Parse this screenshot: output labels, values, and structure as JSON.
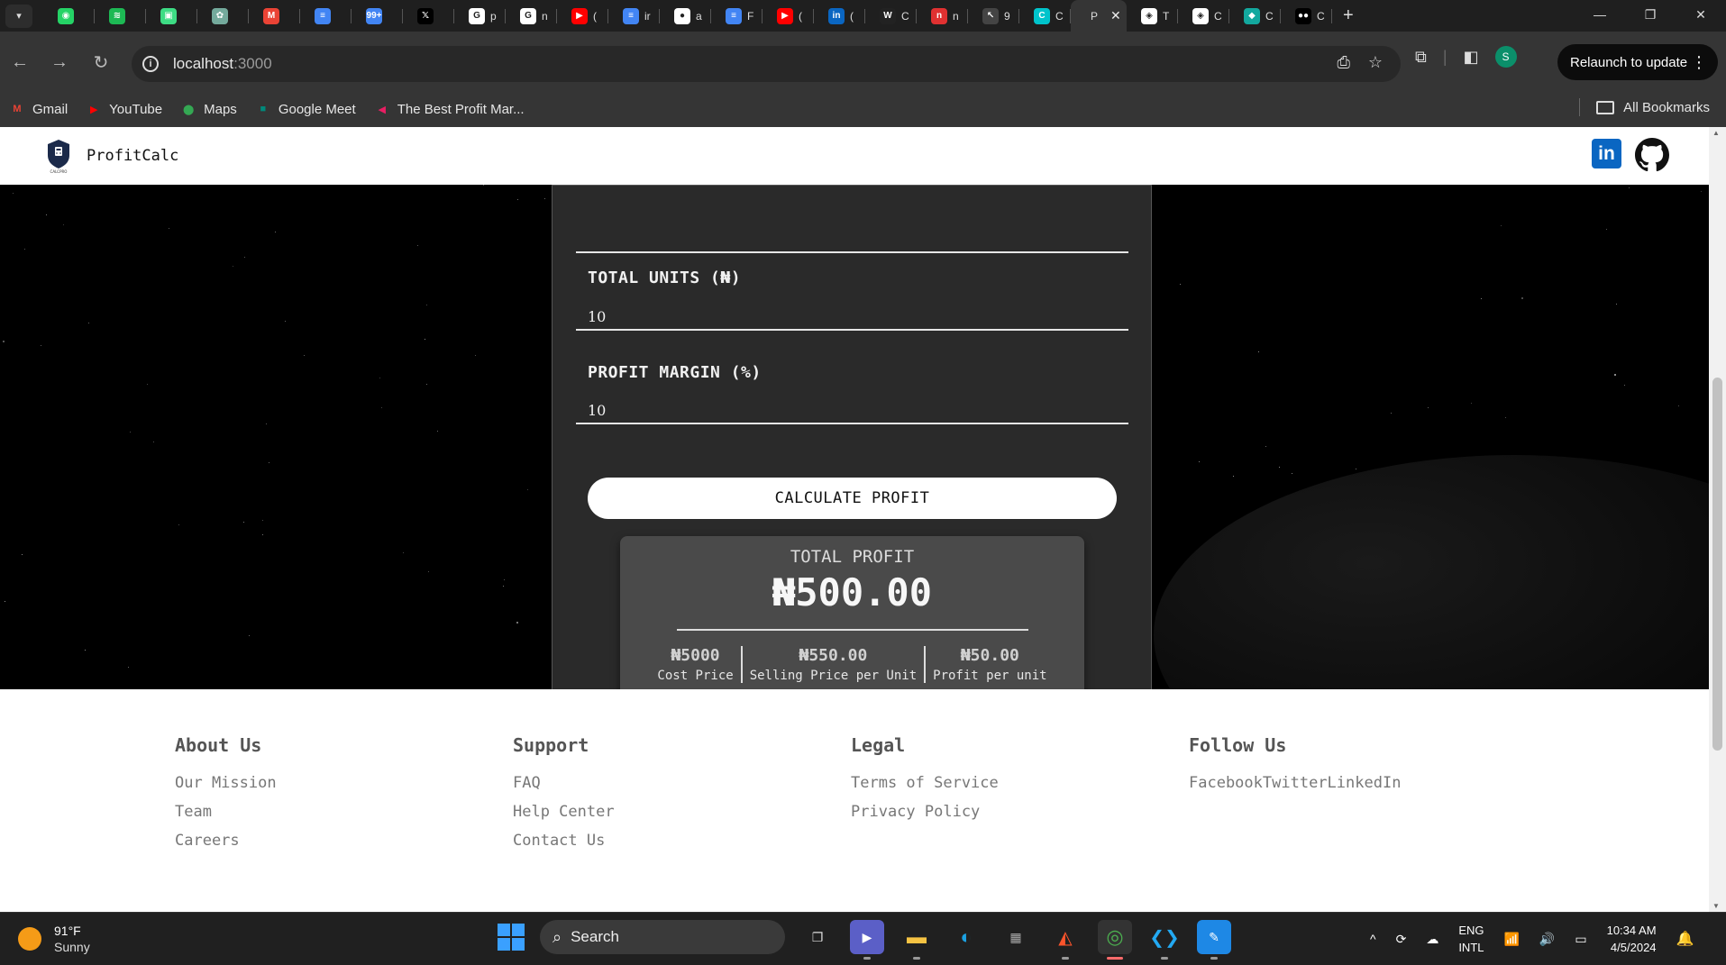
{
  "browser": {
    "tabs": [
      {
        "icon": "whatsapp-icon",
        "color": "#25d366",
        "glyph": "◉",
        "label": ""
      },
      {
        "icon": "spotify-icon",
        "color": "#1db954",
        "glyph": "≋",
        "label": ""
      },
      {
        "icon": "android-icon",
        "color": "#3ddc84",
        "glyph": "▣",
        "label": ""
      },
      {
        "icon": "chatgpt-icon",
        "color": "#74aa9c",
        "glyph": "✿",
        "label": ""
      },
      {
        "icon": "gmail-icon",
        "color": "#ea4335",
        "glyph": "M",
        "label": ""
      },
      {
        "icon": "docs-icon",
        "color": "#4285f4",
        "glyph": "≡",
        "label": ""
      },
      {
        "icon": "badge-icon",
        "color": "#4285f4",
        "glyph": "99+",
        "label": ""
      },
      {
        "icon": "x-icon",
        "color": "#000000",
        "glyph": "𝕏",
        "label": ""
      },
      {
        "icon": "google-icon",
        "color": "#ffffff",
        "glyph": "G",
        "label": "p"
      },
      {
        "icon": "google-icon",
        "color": "#ffffff",
        "glyph": "G",
        "label": "n"
      },
      {
        "icon": "youtube-icon",
        "color": "#ff0000",
        "glyph": "▶",
        "label": "("
      },
      {
        "icon": "docs-icon",
        "color": "#4285f4",
        "glyph": "≡",
        "label": "ir"
      },
      {
        "icon": "github-icon",
        "color": "#ffffff",
        "glyph": "●",
        "label": "a"
      },
      {
        "icon": "docs-icon",
        "color": "#4285f4",
        "glyph": "≡",
        "label": "F"
      },
      {
        "icon": "youtube-icon",
        "color": "#ff0000",
        "glyph": "▶",
        "label": "("
      },
      {
        "icon": "linkedin-icon",
        "color": "#0a66c2",
        "glyph": "in",
        "label": "("
      },
      {
        "icon": "w-icon",
        "color": "#222222",
        "glyph": "W",
        "label": "C"
      },
      {
        "icon": "n-icon",
        "color": "#e03131",
        "glyph": "n",
        "label": "n"
      },
      {
        "icon": "cursor-icon",
        "color": "#444444",
        "glyph": "↖",
        "label": "9"
      },
      {
        "icon": "canva-icon",
        "color": "#00c4cc",
        "glyph": "C",
        "label": "C"
      },
      {
        "icon": "",
        "color": "#353535",
        "glyph": "",
        "label": "P",
        "active": true
      },
      {
        "icon": "codepen-icon",
        "color": "#ffffff",
        "glyph": "◈",
        "label": "T"
      },
      {
        "icon": "codepen-icon",
        "color": "#ffffff",
        "glyph": "◈",
        "label": "C"
      },
      {
        "icon": "diamond-icon",
        "color": "#13a89e",
        "glyph": "◆",
        "label": "C"
      },
      {
        "icon": "medium-icon",
        "color": "#000000",
        "glyph": "●●",
        "label": "C"
      }
    ],
    "address": {
      "host": "localhost",
      "port": ":3000"
    },
    "relaunch_label": "Relaunch to update",
    "profile_initial": "S",
    "bookmarks": [
      {
        "icon": "gmail-icon",
        "label": "Gmail",
        "color": "#ea4335",
        "glyph": "M"
      },
      {
        "icon": "youtube-icon",
        "label": "YouTube",
        "color": "#ff0000",
        "glyph": "▶"
      },
      {
        "icon": "maps-icon",
        "label": "Maps",
        "color": "#34a853",
        "glyph": "⬤"
      },
      {
        "icon": "meet-icon",
        "label": "Google Meet",
        "color": "#00897b",
        "glyph": "■"
      },
      {
        "icon": "profit-icon",
        "label": "The Best Profit Mar...",
        "color": "#e91e63",
        "glyph": "◀"
      }
    ],
    "all_bookmarks_label": "All Bookmarks"
  },
  "app": {
    "brand": "ProfitCalc",
    "logo_caption": "CALCPRO"
  },
  "form": {
    "units_label": "TOTAL UNITS (₦)",
    "units_value": "10",
    "margin_label": "PROFIT MARGIN (%)",
    "margin_value": "10",
    "button_label": "CALCULATE PROFIT"
  },
  "result": {
    "title": "TOTAL PROFIT",
    "value": "₦500.00",
    "stats": [
      {
        "value": "₦5000",
        "label": "Cost Price"
      },
      {
        "value": "₦550.00",
        "label": "Selling Price per Unit"
      },
      {
        "value": "₦50.00",
        "label": "Profit per unit"
      }
    ]
  },
  "footer": {
    "columns": [
      {
        "heading": "About Us",
        "links": [
          "Our Mission",
          "Team",
          "Careers"
        ]
      },
      {
        "heading": "Support",
        "links": [
          "FAQ",
          "Help Center",
          "Contact Us"
        ]
      },
      {
        "heading": "Legal",
        "links": [
          "Terms of Service",
          "Privacy Policy"
        ]
      },
      {
        "heading": "Follow Us",
        "inline_links": [
          "Facebook",
          "Twitter",
          "LinkedIn"
        ]
      }
    ]
  },
  "taskbar": {
    "temperature": "91°F",
    "condition": "Sunny",
    "search_placeholder": "Search",
    "lang_line1": "ENG",
    "lang_line2": "INTL",
    "time": "10:34 AM",
    "date": "4/5/2024"
  }
}
